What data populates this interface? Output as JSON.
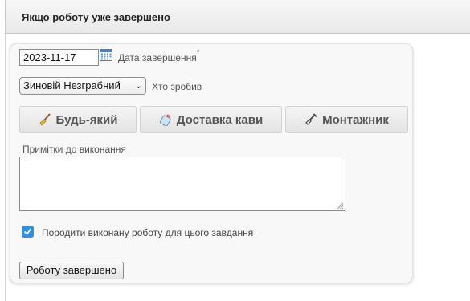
{
  "header": {
    "title": "Якщо роботу уже завершено"
  },
  "form": {
    "completion_date": {
      "value": "2023-11-17",
      "label": "Дата завершення",
      "required_mark": "*"
    },
    "performer": {
      "selected": "Зиновій Незграбний",
      "label": "Хто зробив"
    },
    "roles": [
      {
        "label": "Будь-який",
        "icon": "broom-icon"
      },
      {
        "label": "Доставка кави",
        "icon": "coffee-icon"
      },
      {
        "label": "Монтажник",
        "icon": "shovel-icon"
      }
    ],
    "notes": {
      "label": "Примітки до виконання",
      "value": ""
    },
    "spawn_checkbox": {
      "checked": true,
      "label": "Породити виконану роботу для цього завдання"
    },
    "submit_label": "Роботу завершено"
  },
  "colors": {
    "checkbox_accent": "#2f8fe0",
    "calendar_icon": "#4a7fc1"
  }
}
